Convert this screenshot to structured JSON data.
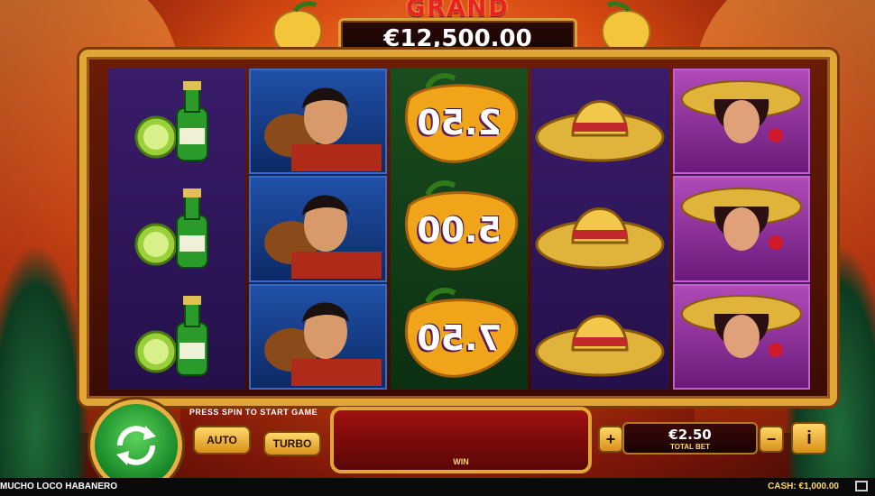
{
  "jackpot": {
    "title": "GRAND",
    "value": "€12,500.00"
  },
  "reels": [
    {
      "symbol": "beer-lime-icon",
      "cells": 3
    },
    {
      "symbol": "guitarist-icon",
      "cells": 3
    },
    {
      "symbol": "pepper-icon",
      "values": [
        "2.50",
        "5.00",
        "7.50"
      ]
    },
    {
      "symbol": "sombrero-icon",
      "cells": 3
    },
    {
      "symbol": "senorita-icon",
      "cells": 3
    }
  ],
  "controls": {
    "press_text": "PRESS SPIN TO START GAME",
    "auto_label": "AUTO",
    "turbo_label": "TURBO",
    "win_label": "WIN",
    "plus_label": "+",
    "minus_label": "−",
    "info_label": "i",
    "total_bet_value": "€2.50",
    "total_bet_label": "TOTAL BET"
  },
  "status": {
    "game_name": "MUCHO LOCO HABANERO",
    "cash_label": "CASH: €1,000.00"
  },
  "colors": {
    "frame_gold": "#e0a636",
    "spin_green": "#1a8a2a",
    "win_red": "#a01010"
  }
}
